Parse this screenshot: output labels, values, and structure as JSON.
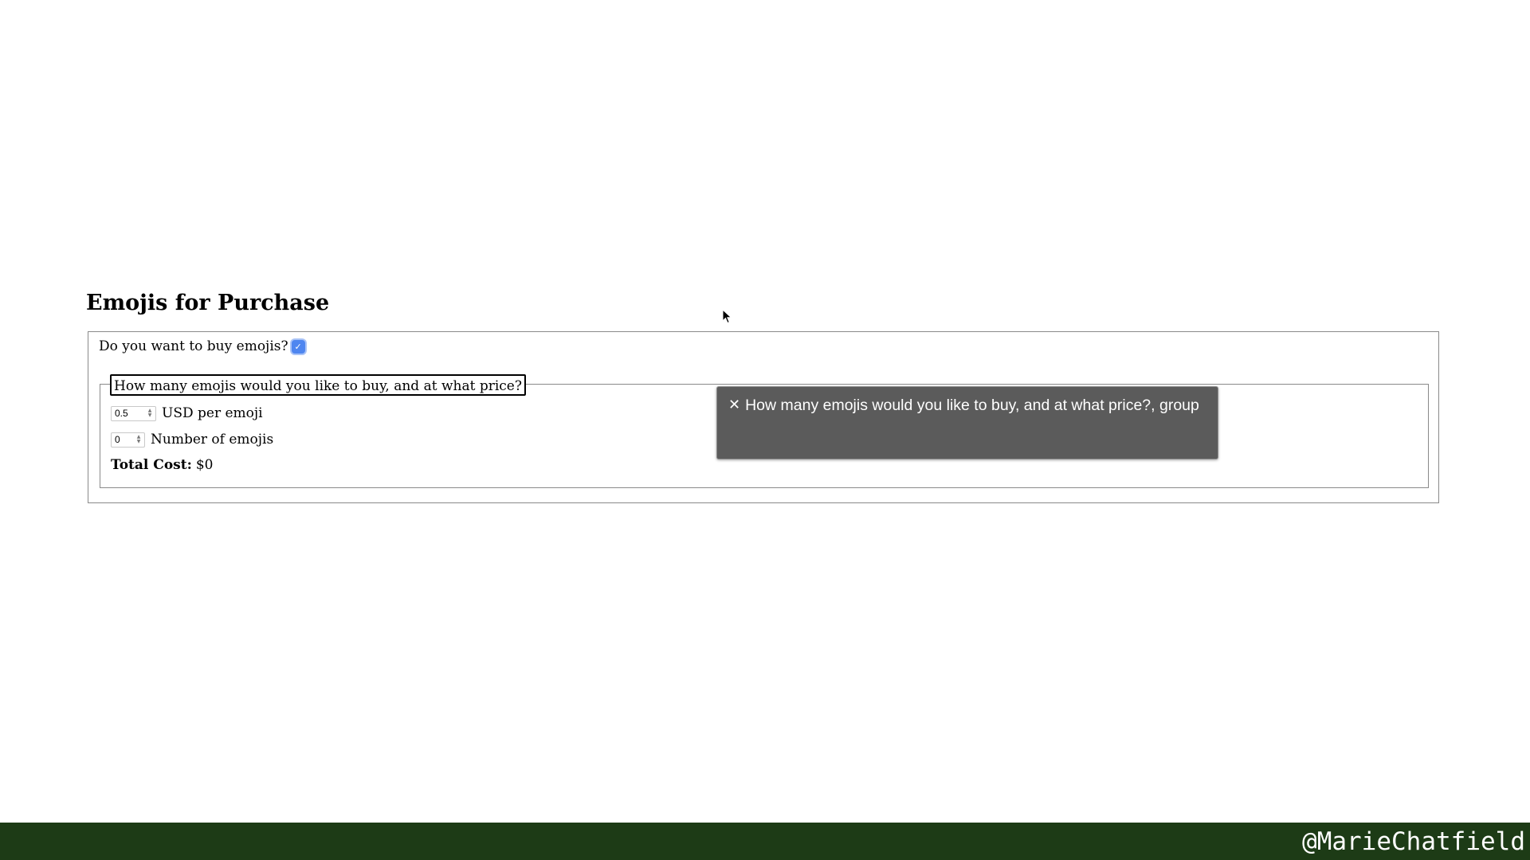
{
  "page": {
    "title": "Emojis for Purchase"
  },
  "buy_question": {
    "label": "Do you want to buy emojis?",
    "checked": true
  },
  "purchase_group": {
    "legend": "How many emojis would you like to buy, and at what price?",
    "price_field": {
      "value": "0.5",
      "label": "USD per emoji"
    },
    "count_field": {
      "value": "0",
      "label": "Number of emojis"
    },
    "total": {
      "label": "Total Cost:",
      "value": "$0"
    }
  },
  "screen_reader_caption": {
    "close_icon": "close-icon",
    "text": "How many emojis would you like to buy, and at what price?, group"
  },
  "footer": {
    "handle": "@MarieChatfield",
    "background_color": "#1d3b16"
  },
  "colors": {
    "checkbox_accent": "#4f86f0",
    "caption_background": "#5b5b5b"
  }
}
